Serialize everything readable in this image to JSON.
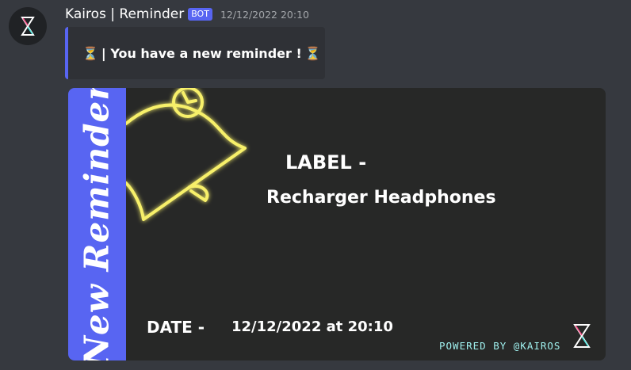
{
  "message": {
    "username": "Kairos | Reminder",
    "badge": "BOT",
    "timestamp": "12/12/2022 20:10",
    "avatar_icon": "hourglass-logo-icon"
  },
  "embed": {
    "text": "| You have a new reminder !",
    "icon": "hourglass-emoji",
    "accent_color": "#5865f2"
  },
  "reminder_card": {
    "stripe_text": "New Reminder",
    "label_title": "LABEL -",
    "label_value": "Recharger Headphones",
    "date_title": "DATE  -",
    "date_value": "12/12/2022 at 20:10",
    "powered_by": "POWERED BY @KAIROS",
    "stripe_color": "#5865f2",
    "bell_color": "#f7f06a"
  }
}
